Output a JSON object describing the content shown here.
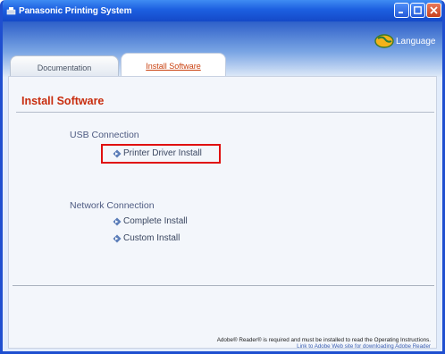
{
  "window": {
    "title": "Panasonic Printing System",
    "buttons": {
      "minimize": "minimize",
      "maximize": "maximize",
      "close": "close"
    }
  },
  "header": {
    "language_label": "Language"
  },
  "tabs": [
    {
      "label": "Documentation",
      "active": false
    },
    {
      "label": "Install Software",
      "active": true
    }
  ],
  "main": {
    "section_title": "Install Software",
    "usb": {
      "label": "USB Connection",
      "items": [
        "Printer Driver Install"
      ]
    },
    "network": {
      "label": "Network Connection",
      "items": [
        "Complete Install",
        "Custom Install"
      ]
    }
  },
  "footer": {
    "note": "Adobe® Reader® is required and must be installed to read the Operating Instructions.",
    "link": "Link to Adobe Web site for downloading Adobe Reader"
  },
  "colors": {
    "accent": "#c82d0e",
    "titlebar": "#1c5fe0",
    "highlight": "#e01010"
  }
}
